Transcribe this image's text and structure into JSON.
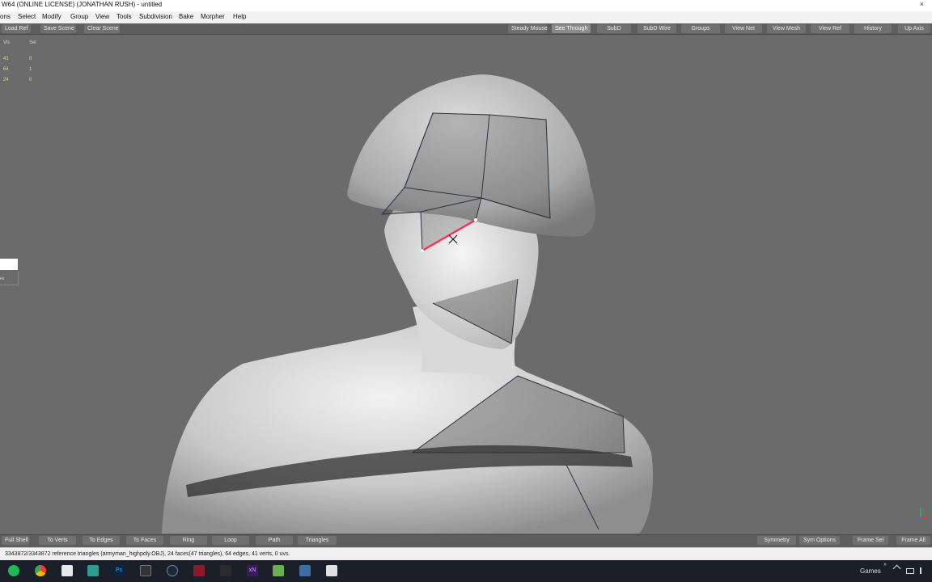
{
  "window": {
    "title": "W64  (ONLINE LICENSE) (JONATHAN RUSH) - untitled",
    "close": "×"
  },
  "menu": [
    "ons",
    "Select",
    "Modify",
    "Group",
    "View",
    "Tools",
    "Subdivision",
    "Bake",
    "Morpher",
    "Help"
  ],
  "toolbar": {
    "left": [
      "Load Ref",
      "Save Scene",
      "Clear Scene"
    ],
    "right": [
      "Steady Mouse",
      "See Through",
      "SubD",
      "SubD Wire",
      "Groups",
      "View Net",
      "View Mesh",
      "View Ref",
      "History",
      "Up Axis"
    ]
  },
  "stats": {
    "headers": [
      "Vis",
      "Sel"
    ],
    "rows": [
      [
        "41",
        "0"
      ],
      [
        "64",
        "1"
      ],
      [
        "24",
        "0"
      ]
    ]
  },
  "side_tab_text": "es",
  "bottombar": {
    "left": [
      "Full Shell",
      "To Verts",
      "To Edges",
      "To Faces",
      "Ring",
      "Loop",
      "Path",
      "Triangles"
    ],
    "right": [
      "Symmetry",
      "Sym Options",
      "Frame Sel",
      "Frame All"
    ]
  },
  "status": "3343872/3343872 reference triangles (armyman_highpoly.OBJ), 24 faces(47 triangles), 64 edges, 41 verts, 0 uvs.",
  "taskbar": {
    "icons": [
      "spotify-icon",
      "chrome-icon",
      "inkscape-icon",
      "app-icon",
      "photoshop-icon",
      "topogun-icon",
      "steam-icon",
      "app-icon-2",
      "app-icon-3",
      "xnormal-icon",
      "app-icon-4",
      "app-icon-5",
      "app-icon-6"
    ],
    "ps_label": "Ps",
    "xn_label": "xN",
    "games_label": "Games",
    "chevron": "»"
  },
  "colors": {
    "viewport": "#6b6b6b",
    "selected_edge": "#ff2a55",
    "wire": "#2a3340"
  }
}
